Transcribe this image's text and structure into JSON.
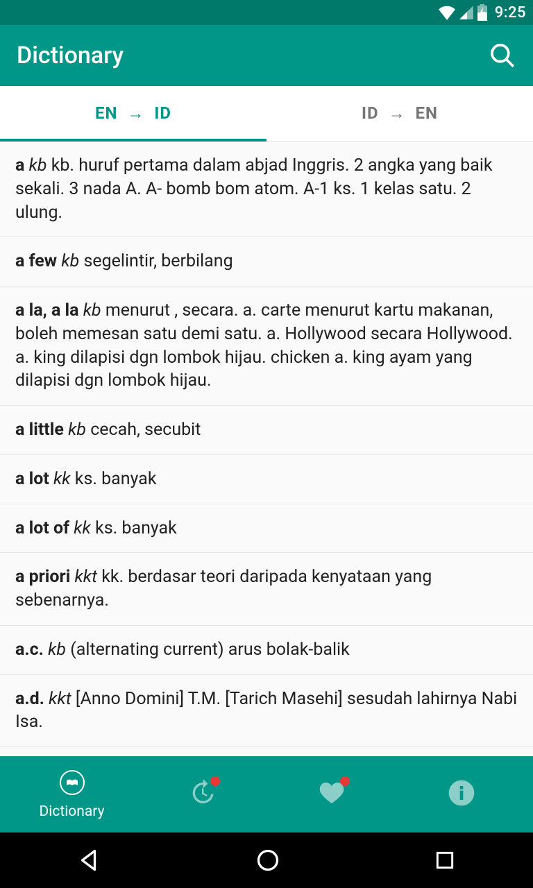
{
  "status": {
    "time": "9:25"
  },
  "appbar": {
    "title": "Dictionary"
  },
  "tabs": {
    "en_id": "EN  →  ID",
    "id_en": "ID  →  EN"
  },
  "entries": [
    {
      "term": "a",
      "type": "kb",
      "def": "kb. huruf pertama dalam abjad Inggris. 2 angka yang baik sekali. 3 nada A. A- bomb bom atom. A-1 ks. 1 kelas satu. 2 ulung."
    },
    {
      "term": "a few",
      "type": "kb",
      "def": "segelintir, berbilang"
    },
    {
      "term": "a la, a la",
      "type": "kb",
      "def": "menurut , secara. a. carte menurut kartu makanan, boleh memesan satu demi satu. a. Hollywood secara Hollywood. a. king dilapisi dgn lombok hijau. chicken a. king ayam yang dilapisi dgn lombok hijau."
    },
    {
      "term": "a little",
      "type": "kb",
      "def": "cecah, secubit"
    },
    {
      "term": "a lot",
      "type": "kk",
      "def": "ks. banyak"
    },
    {
      "term": "a lot of",
      "type": "kk",
      "def": "ks. banyak"
    },
    {
      "term": "a priori",
      "type": "kkt",
      "def": "kk. berdasar teori daripada kenyataan yang sebenarnya."
    },
    {
      "term": "a.c.",
      "type": "kb",
      "def": "(alternating current) arus bolak-balik"
    },
    {
      "term": "a.d.",
      "type": "kkt",
      "def": "[Anno Domini] T.M. [Tarich Masehi] sesudah lahirnya Nabi Isa."
    }
  ],
  "bottomnav": {
    "dictionary": "Dictionary"
  }
}
